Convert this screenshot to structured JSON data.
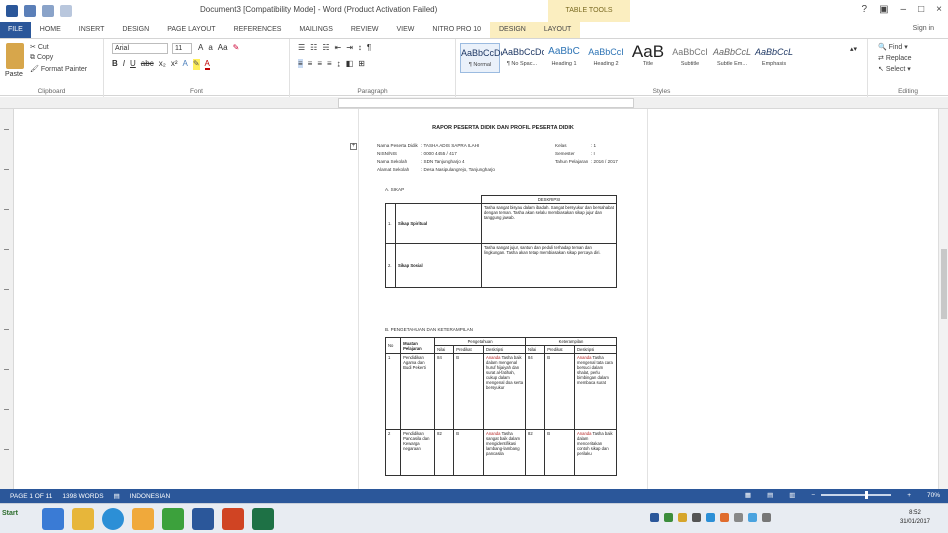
{
  "window": {
    "title": "Document3 [Compatibility Mode] - Word (Product Activation Failed)",
    "context_tab_group": "TABLE TOOLS",
    "signin": "Sign in"
  },
  "tabs": [
    "FILE",
    "HOME",
    "INSERT",
    "DESIGN",
    "PAGE LAYOUT",
    "REFERENCES",
    "MAILINGS",
    "REVIEW",
    "VIEW",
    "NITRO PRO 10",
    "DESIGN",
    "LAYOUT"
  ],
  "ribbon": {
    "clipboard": {
      "paste": "Paste",
      "cut": "Cut",
      "copy": "Copy",
      "format_painter": "Format Painter",
      "label": "Clipboard"
    },
    "font": {
      "name": "Arial",
      "size": "11",
      "label": "Font",
      "format_buttons": [
        "B",
        "I",
        "U",
        "abc",
        "x₂",
        "x²"
      ]
    },
    "paragraph": {
      "label": "Paragraph"
    },
    "styles": {
      "label": "Styles",
      "items": [
        {
          "sample": "AaBbCcDc",
          "name": "¶ Normal"
        },
        {
          "sample": "AaBbCcDc",
          "name": "¶ No Spac..."
        },
        {
          "sample": "AaBbC",
          "name": "Heading 1"
        },
        {
          "sample": "AaBbCcI",
          "name": "Heading 2"
        },
        {
          "sample": "AaB",
          "name": "Title"
        },
        {
          "sample": "AaBbCcI",
          "name": "Subtitle"
        },
        {
          "sample": "AaBbCcL",
          "name": "Subtle Em..."
        },
        {
          "sample": "AaBbCcL",
          "name": "Emphasis"
        }
      ]
    },
    "editing": {
      "find": "Find",
      "replace": "Replace",
      "select": "Select",
      "label": "Editing"
    }
  },
  "document": {
    "title": "RAPOR PESERTA DIDIK DAN PROFIL PESERTA DIDIK",
    "info_left": [
      {
        "label": "Nama Peserta Didik",
        "value": ": TASHA ADIS SAPRA ILAHI"
      },
      {
        "label": "NISN/NIS",
        "value": ": 0000 4455 / 417"
      },
      {
        "label": "Nama Sekolah",
        "value": ": SDN Tanjungharjo 4"
      },
      {
        "label": "Alamat Sekolah",
        "value": ": Desa Nasipulangrejo, Tanjungharjo"
      }
    ],
    "info_right": [
      {
        "label": "Kelas",
        "value": ": 1"
      },
      {
        "label": "Semester",
        "value": ": I"
      },
      {
        "label": "Tahun Pelajaran",
        "value": ": 2016 / 2017"
      }
    ],
    "section_a": "A.   SIKAP",
    "sikap_header": "DESKRIPSI",
    "sikap_rows": [
      {
        "no": "1.",
        "label": "Sikap Spiritual",
        "desc": "Tasha sangat bisyau dalam ibadah. Sangat bersyukur dan bersahabat dengan teman. Tasha akan selalu membiasakan sikap jujur dan tanggung jawab."
      },
      {
        "no": "2.",
        "label": "Sikap Sosial",
        "desc": "Tasha sangat jujur, santun dan peduli terhadap teman dan lingkungan. Tasha akan tetap membiasakan sikap percaya diri."
      }
    ],
    "section_b": "B.   PENGETAHUAN DAN KETERAMPILAN",
    "kt_headers": {
      "no": "No",
      "mapel": "Muatan Pelajaran",
      "peng": "Pengetahuan",
      "ket": "Keterampilan",
      "nilai": "Nilai",
      "predikat": "Predikat",
      "deskripsi": "Deskripsi"
    },
    "kt_rows": [
      {
        "no": "1",
        "mapel": "Pendidikan Agama dan Budi Pekerti",
        "n1": "84",
        "p1": "B",
        "d1_hl": "Ananda",
        "d1": "Tasha baik dalam mengenal huruf hijaiyah dan surat al-fatihah, cukup dalam mengenal doa serta bersyukur",
        "n2": "84",
        "p2": "B",
        "d2_hl": "Ananda",
        "d2": "Tasha mengenal tata cara bersuci dalam shalat, perlu bimbingan dalam membaca surat"
      },
      {
        "no": "2",
        "mapel": "Pendidikan Pancasila dan Kewarga negaraan",
        "n1": "82",
        "p1": "B",
        "d1_hl": "Ananda",
        "d1": "Tasha sangat baik dalam mengidentifikasi lambang-lambang pancasila",
        "n2": "82",
        "p2": "B",
        "d2_hl": "Ananda",
        "d2": "Tasha baik dalam menceritakan contoh sikap dan perilaku"
      }
    ]
  },
  "statusbar": {
    "page": "PAGE 1 OF 11",
    "words": "1398 WORDS",
    "language": "INDONESIAN",
    "zoom": "70%"
  },
  "taskbar": {
    "start": "Start",
    "time": "8:52",
    "date": "31/01/2017"
  }
}
